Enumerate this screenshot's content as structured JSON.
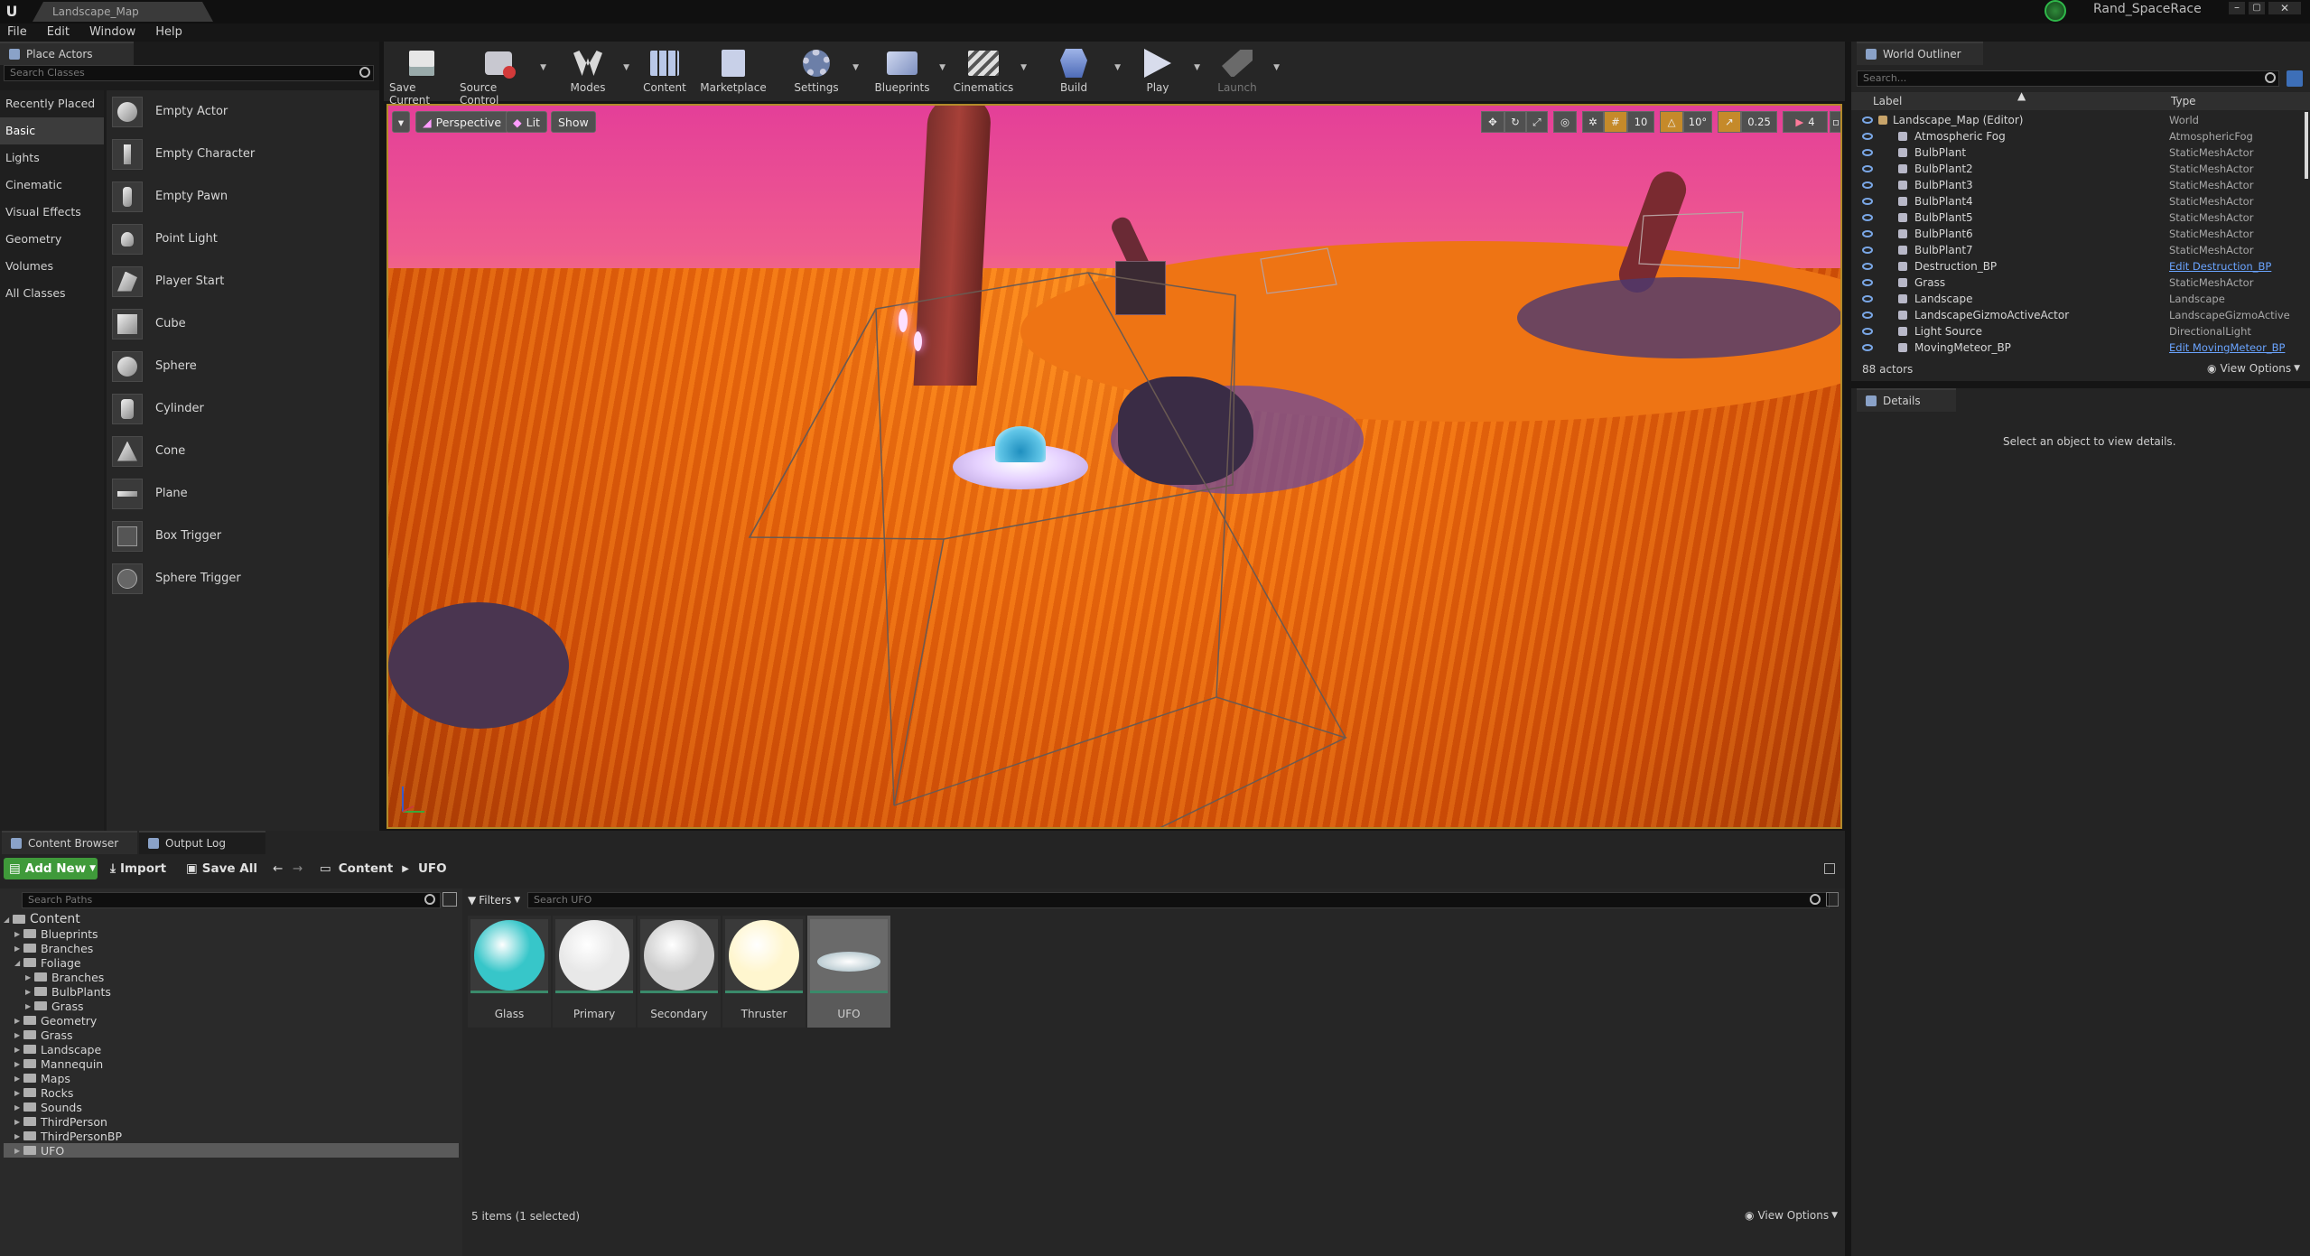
{
  "window": {
    "tab_title": "Landscape_Map",
    "project_name": "Rand_SpaceRace"
  },
  "menu": [
    "File",
    "Edit",
    "Window",
    "Help"
  ],
  "place_actors": {
    "tab_label": "Place Actors",
    "search_placeholder": "Search Classes",
    "categories": [
      "Recently Placed",
      "Basic",
      "Lights",
      "Cinematic",
      "Visual Effects",
      "Geometry",
      "Volumes",
      "All Classes"
    ],
    "selected_category": "Basic",
    "items": [
      "Empty Actor",
      "Empty Character",
      "Empty Pawn",
      "Point Light",
      "Player Start",
      "Cube",
      "Sphere",
      "Cylinder",
      "Cone",
      "Plane",
      "Box Trigger",
      "Sphere Trigger"
    ]
  },
  "toolbar": {
    "buttons": [
      {
        "label": "Save Current",
        "icon": "save-icon"
      },
      {
        "label": "Source Control",
        "icon": "source-control-icon"
      },
      {
        "label": "Modes",
        "icon": "modes-icon"
      },
      {
        "label": "Content",
        "icon": "content-icon"
      },
      {
        "label": "Marketplace",
        "icon": "marketplace-icon"
      },
      {
        "label": "Settings",
        "icon": "settings-icon"
      },
      {
        "label": "Blueprints",
        "icon": "blueprints-icon"
      },
      {
        "label": "Cinematics",
        "icon": "cinematics-icon"
      },
      {
        "label": "Build",
        "icon": "build-icon"
      },
      {
        "label": "Play",
        "icon": "play-icon"
      },
      {
        "label": "Launch",
        "icon": "launch-icon"
      }
    ]
  },
  "viewport": {
    "perspective_label": "Perspective",
    "lit_label": "Lit",
    "show_label": "Show",
    "grid_snap": "10",
    "rotation_snap": "10°",
    "scale_snap": "0.25",
    "camera_speed": "4"
  },
  "world_outliner": {
    "tab_label": "World Outliner",
    "search_placeholder": "Search...",
    "col_label": "Label",
    "col_type": "Type",
    "rows": [
      {
        "label": "Landscape_Map (Editor)",
        "type": "World",
        "link": false
      },
      {
        "label": "Atmospheric Fog",
        "type": "AtmosphericFog",
        "link": false
      },
      {
        "label": "BulbPlant",
        "type": "StaticMeshActor",
        "link": false
      },
      {
        "label": "BulbPlant2",
        "type": "StaticMeshActor",
        "link": false
      },
      {
        "label": "BulbPlant3",
        "type": "StaticMeshActor",
        "link": false
      },
      {
        "label": "BulbPlant4",
        "type": "StaticMeshActor",
        "link": false
      },
      {
        "label": "BulbPlant5",
        "type": "StaticMeshActor",
        "link": false
      },
      {
        "label": "BulbPlant6",
        "type": "StaticMeshActor",
        "link": false
      },
      {
        "label": "BulbPlant7",
        "type": "StaticMeshActor",
        "link": false
      },
      {
        "label": "Destruction_BP",
        "type": "Edit Destruction_BP",
        "link": true
      },
      {
        "label": "Grass",
        "type": "StaticMeshActor",
        "link": false
      },
      {
        "label": "Landscape",
        "type": "Landscape",
        "link": false
      },
      {
        "label": "LandscapeGizmoActiveActor",
        "type": "LandscapeGizmoActive",
        "link": false
      },
      {
        "label": "Light Source",
        "type": "DirectionalLight",
        "link": false
      },
      {
        "label": "MovingMeteor_BP",
        "type": "Edit MovingMeteor_BP",
        "link": true
      }
    ],
    "actor_count": "88 actors",
    "view_options": "View Options"
  },
  "details": {
    "tab_label": "Details",
    "empty_message": "Select an object to view details."
  },
  "content_browser": {
    "tab_label": "Content Browser",
    "output_log_tab": "Output Log",
    "add_new": "Add New",
    "import": "Import",
    "save_all": "Save All",
    "path": [
      "Content",
      "UFO"
    ],
    "search_paths_placeholder": "Search Paths",
    "filters_label": "Filters",
    "search_assets_placeholder": "Search UFO",
    "tree": [
      {
        "label": "Content",
        "depth": 0,
        "expanded": true
      },
      {
        "label": "Blueprints",
        "depth": 1,
        "expanded": false
      },
      {
        "label": "Branches",
        "depth": 1,
        "expanded": false
      },
      {
        "label": "Foliage",
        "depth": 1,
        "expanded": true
      },
      {
        "label": "Branches",
        "depth": 2,
        "expanded": false
      },
      {
        "label": "BulbPlants",
        "depth": 2,
        "expanded": false
      },
      {
        "label": "Grass",
        "depth": 2,
        "expanded": false
      },
      {
        "label": "Geometry",
        "depth": 1,
        "expanded": false
      },
      {
        "label": "Grass",
        "depth": 1,
        "expanded": false
      },
      {
        "label": "Landscape",
        "depth": 1,
        "expanded": false
      },
      {
        "label": "Mannequin",
        "depth": 1,
        "expanded": false
      },
      {
        "label": "Maps",
        "depth": 1,
        "expanded": false
      },
      {
        "label": "Rocks",
        "depth": 1,
        "expanded": false
      },
      {
        "label": "Sounds",
        "depth": 1,
        "expanded": false
      },
      {
        "label": "ThirdPerson",
        "depth": 1,
        "expanded": false
      },
      {
        "label": "ThirdPersonBP",
        "depth": 1,
        "expanded": false
      },
      {
        "label": "UFO",
        "depth": 1,
        "expanded": false,
        "selected": true
      }
    ],
    "assets": [
      {
        "name": "Glass",
        "color": "#37c6c9"
      },
      {
        "name": "Primary",
        "color": "#e8e8e8"
      },
      {
        "name": "Secondary",
        "color": "#cfcfcf"
      },
      {
        "name": "Thruster",
        "color": "#fff6cf"
      },
      {
        "name": "UFO",
        "color": "#9fb7c0",
        "selected": true
      }
    ],
    "status": "5 items (1 selected)",
    "view_options": "View Options"
  },
  "colors": {
    "accent_green": "#4caf50",
    "viewport_border": "#b28a2a",
    "link_blue": "#6aa4ff"
  }
}
